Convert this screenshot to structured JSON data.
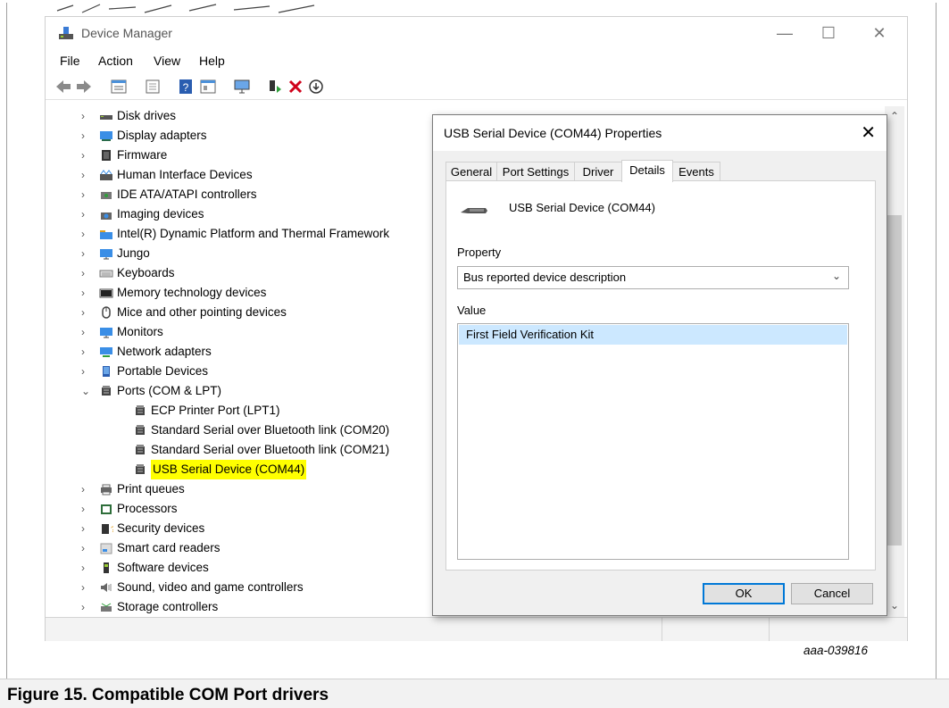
{
  "window": {
    "title": "Device Manager",
    "controls": [
      "minimize",
      "maximize",
      "close"
    ]
  },
  "menu": [
    "File",
    "Action",
    "View",
    "Help"
  ],
  "toolbar_icons": [
    "back-icon",
    "forward-icon",
    "properties-icon",
    "update-icon",
    "help-icon",
    "view-icon",
    "monitor-icon",
    "add-driver-icon",
    "uninstall-icon",
    "download-icon"
  ],
  "tree": [
    {
      "label": "Disk drives",
      "icon": "disk-icon",
      "expanded": false
    },
    {
      "label": "Display adapters",
      "icon": "display-icon",
      "expanded": false
    },
    {
      "label": "Firmware",
      "icon": "firmware-icon",
      "expanded": false
    },
    {
      "label": "Human Interface Devices",
      "icon": "hid-icon",
      "expanded": false
    },
    {
      "label": "IDE ATA/ATAPI controllers",
      "icon": "ide-icon",
      "expanded": false
    },
    {
      "label": "Imaging devices",
      "icon": "camera-icon",
      "expanded": false
    },
    {
      "label": "Intel(R) Dynamic Platform and Thermal Framework",
      "icon": "folder-icon",
      "expanded": false
    },
    {
      "label": "Jungo",
      "icon": "monitor-icon",
      "expanded": false
    },
    {
      "label": "Keyboards",
      "icon": "keyboard-icon",
      "expanded": false
    },
    {
      "label": "Memory technology devices",
      "icon": "memory-icon",
      "expanded": false
    },
    {
      "label": "Mice and other pointing devices",
      "icon": "mouse-icon",
      "expanded": false
    },
    {
      "label": "Monitors",
      "icon": "monitor-icon",
      "expanded": false
    },
    {
      "label": "Network adapters",
      "icon": "network-icon",
      "expanded": false
    },
    {
      "label": "Portable Devices",
      "icon": "portable-icon",
      "expanded": false
    },
    {
      "label": "Ports (COM & LPT)",
      "icon": "port-icon",
      "expanded": true
    },
    {
      "label": "ECP Printer Port (LPT1)",
      "icon": "port-icon",
      "child": true
    },
    {
      "label": "Standard Serial over Bluetooth link (COM20)",
      "icon": "port-icon",
      "child": true
    },
    {
      "label": "Standard Serial over Bluetooth link (COM21)",
      "icon": "port-icon",
      "child": true
    },
    {
      "label": "USB Serial Device (COM44)",
      "icon": "port-icon",
      "child": true,
      "highlighted": true
    },
    {
      "label": "Print queues",
      "icon": "printer-icon",
      "expanded": false
    },
    {
      "label": "Processors",
      "icon": "processor-icon",
      "expanded": false
    },
    {
      "label": "Security devices",
      "icon": "security-icon",
      "expanded": false
    },
    {
      "label": "Smart card readers",
      "icon": "smartcard-icon",
      "expanded": false
    },
    {
      "label": "Software devices",
      "icon": "software-icon",
      "expanded": false
    },
    {
      "label": "Sound, video and game controllers",
      "icon": "speaker-icon",
      "expanded": false
    },
    {
      "label": "Storage controllers",
      "icon": "storage-icon",
      "expanded": false
    }
  ],
  "dialog": {
    "title": "USB Serial Device (COM44) Properties",
    "tabs": [
      "General",
      "Port Settings",
      "Driver",
      "Details",
      "Events"
    ],
    "active_tab": "Details",
    "device_name": "USB Serial Device (COM44)",
    "property_label": "Property",
    "property_value": "Bus reported device description",
    "value_label": "Value",
    "value_item": "First Field Verification Kit",
    "ok_label": "OK",
    "cancel_label": "Cancel"
  },
  "figure_id": "aaa-039816",
  "caption": "Figure 15.  Compatible COM Port drivers",
  "colors": {
    "highlight": "#ffff00",
    "selection": "#cce8ff",
    "accent": "#0078d7"
  }
}
